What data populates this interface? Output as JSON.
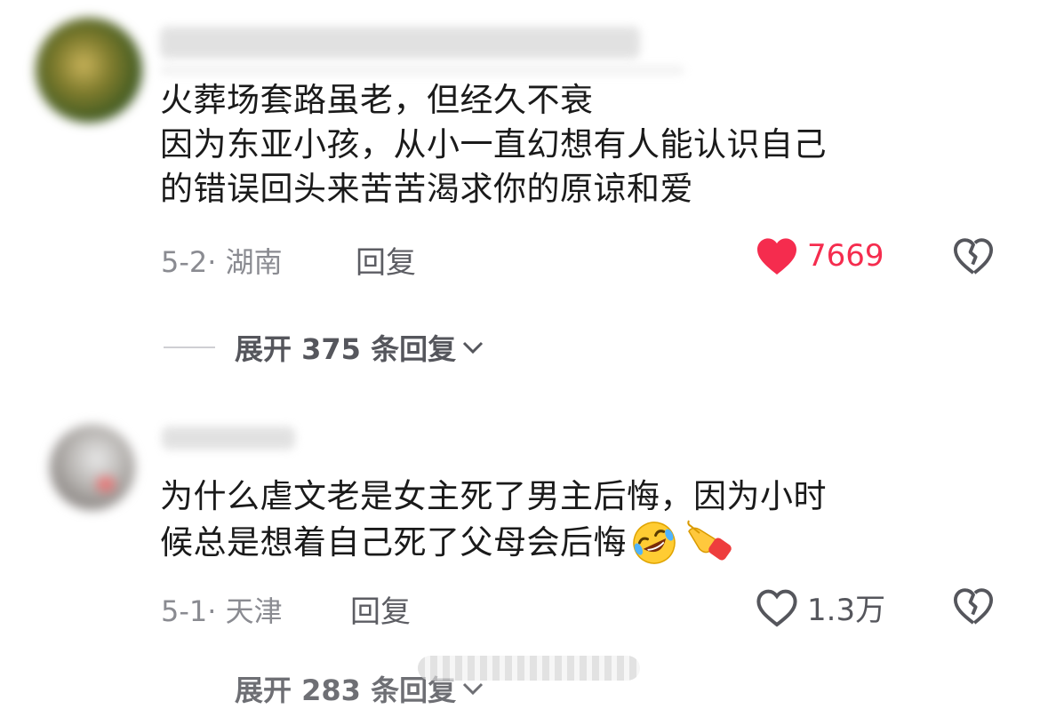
{
  "comments": [
    {
      "lines": [
        "火葬场套路虽老，但经久不衰",
        "因为东亚小孩，从小一直幻想有人能认识自己",
        "的错误回头来苦苦渴求你的原谅和爱"
      ],
      "date_location": "5-2· 湖南",
      "reply_label": "回复",
      "likes": "7669",
      "liked": true,
      "expand_label": "展开 375 条回复"
    },
    {
      "lines": [
        "为什么虐文老是女主死了男主后悔，因为小时",
        "候总是想着自己死了父母会后悔"
      ],
      "emojis": [
        "rofl-emoji",
        "pointing-hand-emoji"
      ],
      "date_location": "5-1· 天津",
      "reply_label": "回复",
      "likes": "1.3万",
      "liked": false,
      "expand_label": "展开 283 条回复"
    }
  ],
  "colors": {
    "like_red": "#fe2c55",
    "text": "#1a1a1a",
    "meta": "#8a8b91"
  }
}
